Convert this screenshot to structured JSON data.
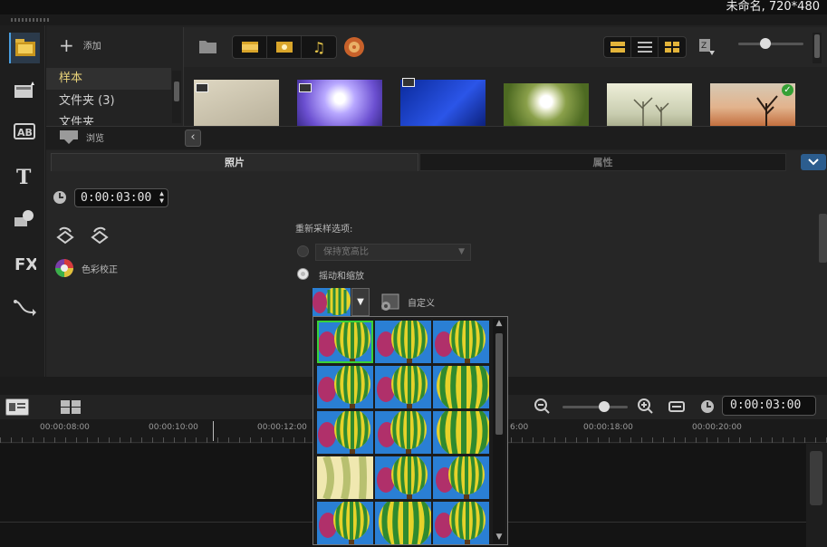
{
  "window": {
    "title": "未命名, 720*480"
  },
  "library": {
    "add_label": "添加",
    "side_items": [
      {
        "label": "样本"
      },
      {
        "label": "文件夹 (3)"
      },
      {
        "label": "文件夹"
      }
    ],
    "browse_label": "浏览",
    "thumbnails": [
      {
        "name": "beige-gradient",
        "type": "video"
      },
      {
        "name": "purple-bokeh",
        "type": "video"
      },
      {
        "name": "blue-abstract",
        "type": "video"
      },
      {
        "name": "dandelion",
        "type": "image"
      },
      {
        "name": "misty-trees",
        "type": "image"
      },
      {
        "name": "desert-tree",
        "type": "image",
        "checked": true
      }
    ]
  },
  "options": {
    "tabs": [
      {
        "label": "照片"
      },
      {
        "label": "属性"
      }
    ],
    "duration": "0:00:03:00",
    "color_correction_label": "色彩校正",
    "resample_heading": "重新采样选项:",
    "keep_aspect_label": "保持宽高比",
    "pan_zoom_label": "摇动和缩放",
    "customize_label": "自定义"
  },
  "timeline": {
    "timecode": "0:00:03:00",
    "ruler_labels": [
      "00:00:08:00",
      "00:00:10:00",
      "00:00:12:00",
      "6:00",
      "00:00:18:00",
      "00:00:20:00"
    ]
  },
  "colors": {
    "accent_blue": "#2c5d8e",
    "selected_green": "#38d238",
    "gold": "#e8d27a"
  }
}
